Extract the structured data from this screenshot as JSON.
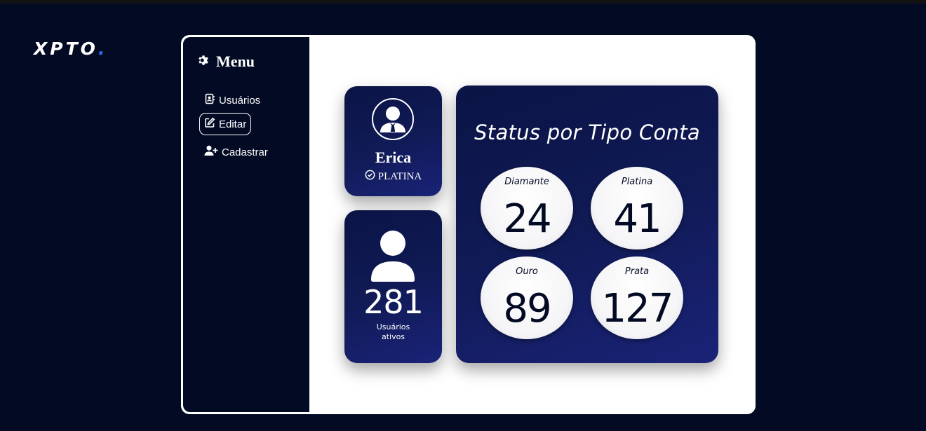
{
  "brand": {
    "name": "XPTO",
    "dot": "."
  },
  "sidebar": {
    "title": "Menu",
    "title_icon": "gear-icon",
    "items": [
      {
        "label": "Usuários",
        "icon": "address-book-icon",
        "active": false
      },
      {
        "label": "Editar",
        "icon": "edit-icon",
        "active": true
      },
      {
        "label": "Cadastrar",
        "icon": "user-plus-icon",
        "active": false
      }
    ]
  },
  "profile": {
    "name": "Erica",
    "tier": "PLATINA",
    "avatar_icon": "user-tie-icon",
    "tier_icon": "check-circle-icon"
  },
  "users": {
    "count": "281",
    "label": "Usuários\nativos",
    "icon": "user-icon"
  },
  "status": {
    "title": "Status por Tipo Conta",
    "items": [
      {
        "label": "Diamante",
        "value": "24"
      },
      {
        "label": "Platina",
        "value": "41"
      },
      {
        "label": "Ouro",
        "value": "89"
      },
      {
        "label": "Prata",
        "value": "127"
      }
    ]
  },
  "colors": {
    "background": "#030a24",
    "panel": "#ffffff",
    "card_gradient_start": "#0b1445",
    "card_gradient_end": "#1a2377",
    "brand_dot": "#2f6cf0"
  }
}
